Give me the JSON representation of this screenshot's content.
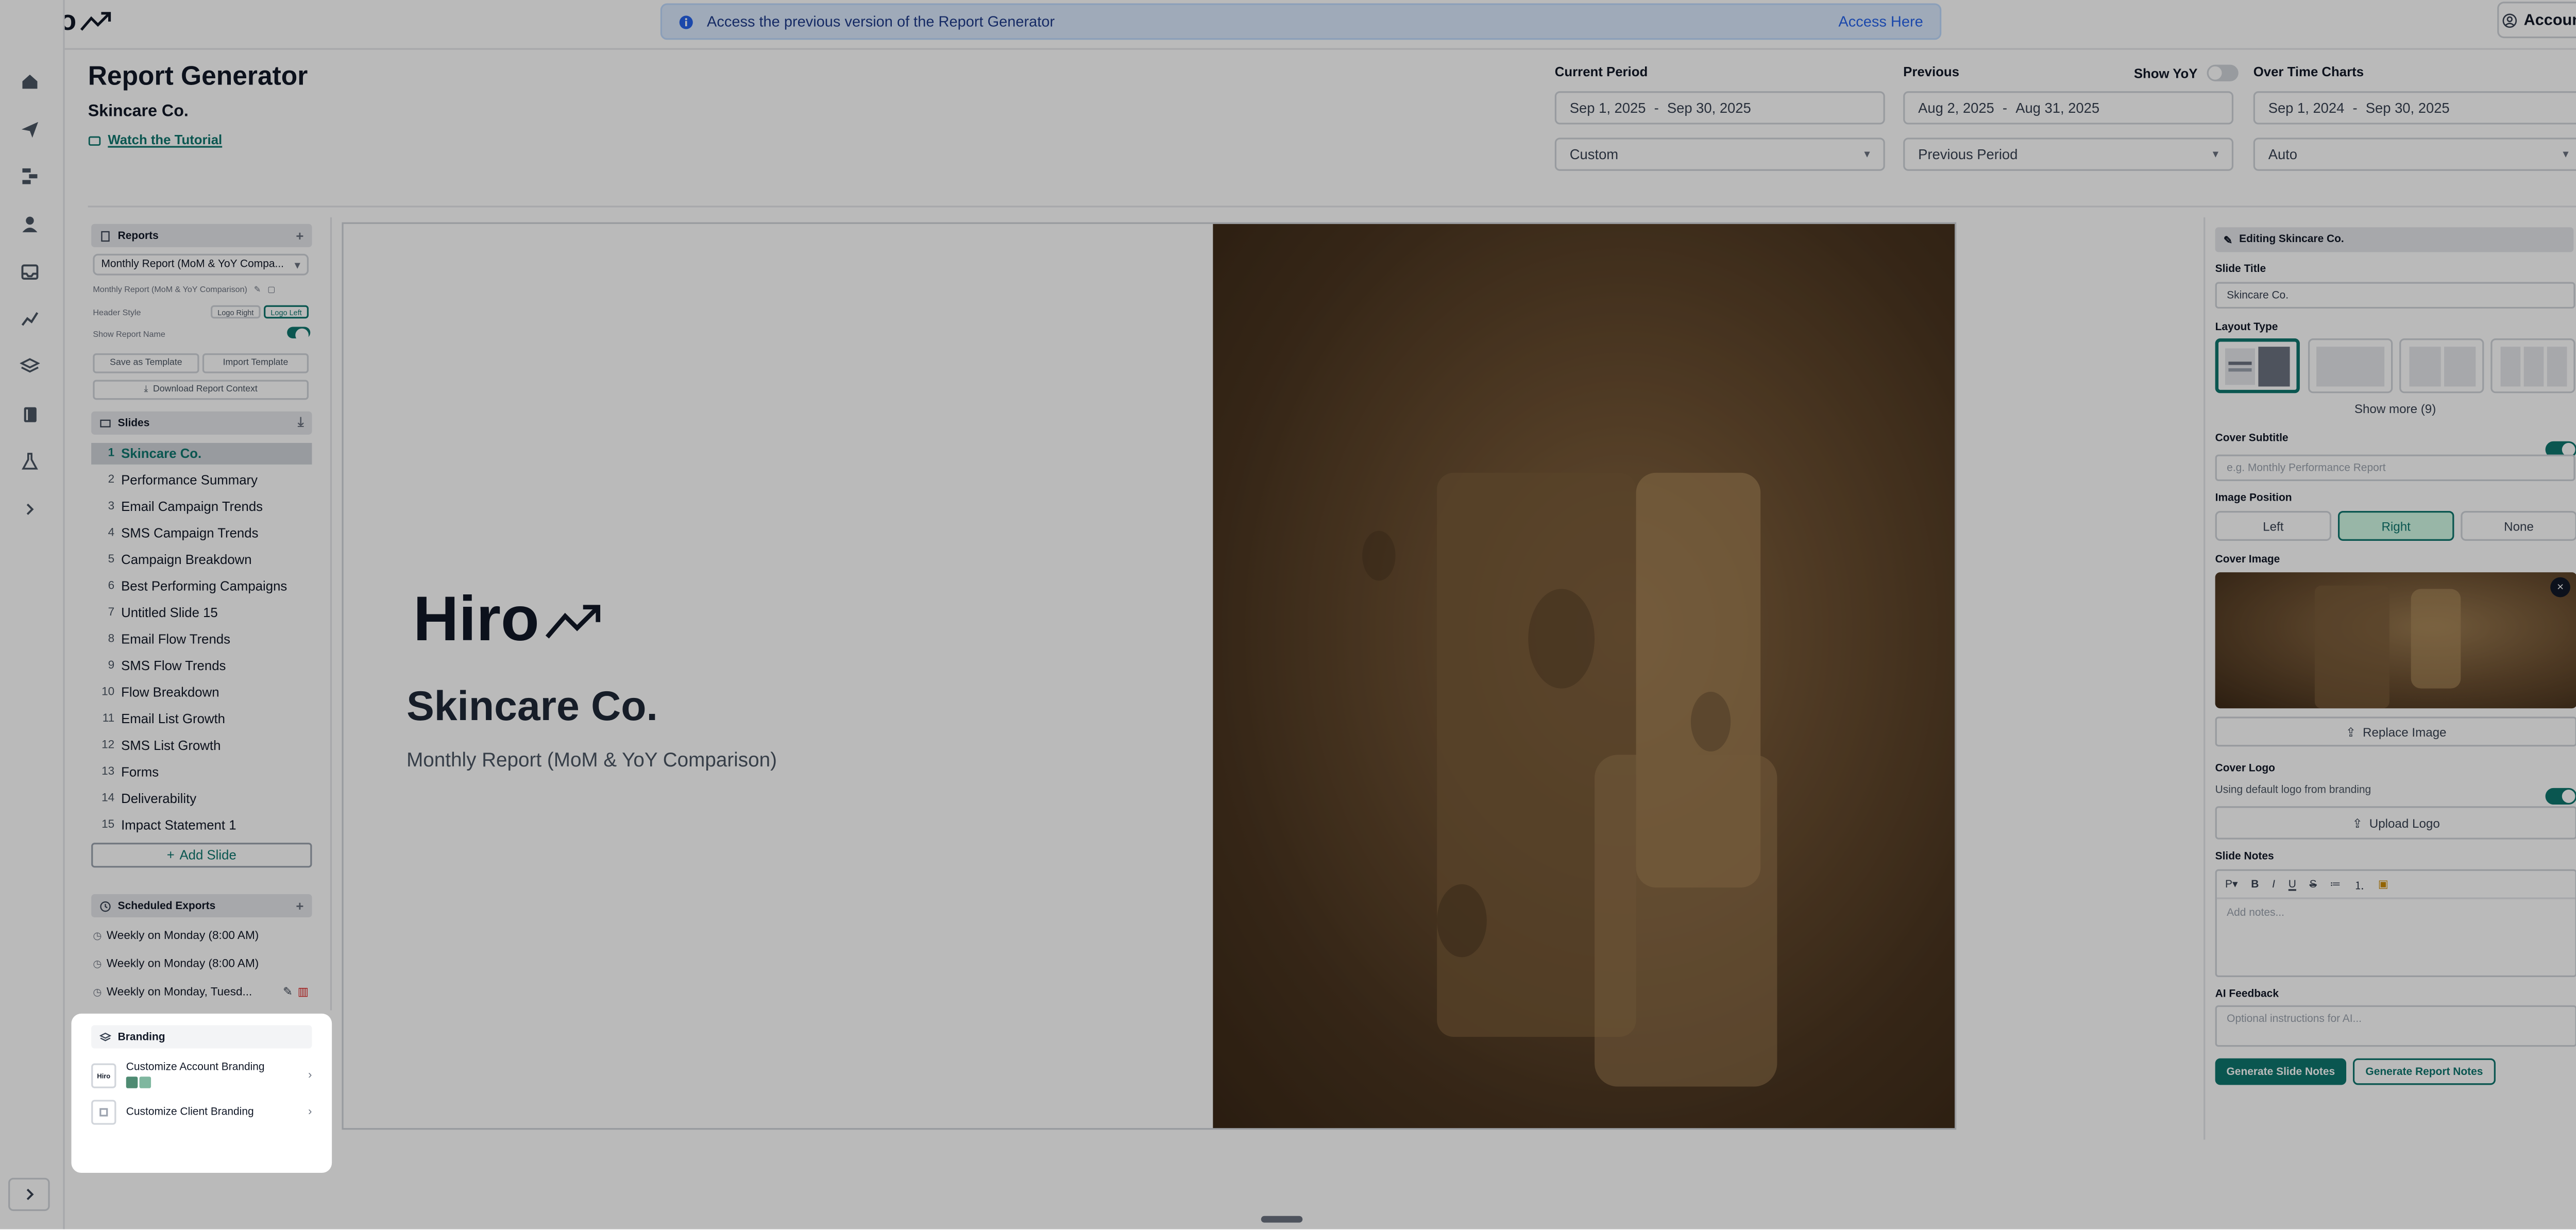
{
  "app": {
    "logo_text": "Hiro",
    "account_label": "Account"
  },
  "banner": {
    "message": "Access the previous version of the Report Generator",
    "link": "Access Here"
  },
  "header": {
    "title": "Report Generator",
    "client": "Skincare Co.",
    "tutorial_link": "Watch the Tutorial",
    "current_period": {
      "label": "Current Period",
      "start": "Sep 1, 2025",
      "end": "Sep 30, 2025",
      "mode": "Custom"
    },
    "previous": {
      "label": "Previous",
      "start": "Aug 2, 2025",
      "end": "Aug 31, 2025",
      "mode": "Previous Period",
      "yoy_label": "Show YoY"
    },
    "over_time": {
      "label": "Over Time Charts",
      "start": "Sep 1, 2024",
      "end": "Sep 30, 2025",
      "mode": "Auto"
    }
  },
  "reports": {
    "heading": "Reports",
    "selected": "Monthly Report (MoM & YoY Compa...",
    "sub_name": "Monthly Report (MoM & YoY Comparison)",
    "header_style_label": "Header Style",
    "header_style_options": [
      "Logo Right",
      "Logo Left"
    ],
    "show_name_label": "Show Report Name",
    "save_template": "Save as Template",
    "import_template": "Import Template",
    "download_context": "Download Report Context"
  },
  "slides": {
    "heading": "Slides",
    "items": [
      {
        "num": "1",
        "title": "Skincare Co."
      },
      {
        "num": "2",
        "title": "Performance Summary"
      },
      {
        "num": "3",
        "title": "Email Campaign Trends"
      },
      {
        "num": "4",
        "title": "SMS Campaign Trends"
      },
      {
        "num": "5",
        "title": "Campaign Breakdown"
      },
      {
        "num": "6",
        "title": "Best Performing Campaigns"
      },
      {
        "num": "7",
        "title": "Untitled Slide 15"
      },
      {
        "num": "8",
        "title": "Email Flow Trends"
      },
      {
        "num": "9",
        "title": "SMS Flow Trends"
      },
      {
        "num": "10",
        "title": "Flow Breakdown"
      },
      {
        "num": "11",
        "title": "Email List Growth"
      },
      {
        "num": "12",
        "title": "SMS List Growth"
      },
      {
        "num": "13",
        "title": "Forms"
      },
      {
        "num": "14",
        "title": "Deliverability"
      },
      {
        "num": "15",
        "title": "Impact Statement 1"
      }
    ],
    "add_label": "Add Slide"
  },
  "scheduled": {
    "heading": "Scheduled Exports",
    "items": [
      "Weekly on Monday (8:00 AM)",
      "Weekly on Monday (8:00 AM)",
      "Weekly on Monday, Tuesd..."
    ]
  },
  "branding": {
    "heading": "Branding",
    "account_item": "Customize Account Branding",
    "client_item": "Customize Client Branding",
    "account_logo_text": "Hiro",
    "swatches": [
      "#4e8b72",
      "#7fb79f"
    ]
  },
  "canvas": {
    "logo_text": "Hiro",
    "title": "Skincare Co.",
    "subtitle": "Monthly Report (MoM & YoY Comparison)"
  },
  "editor": {
    "heading": "Editing Skincare Co.",
    "slide_title_label": "Slide Title",
    "slide_title_value": "Skincare Co.",
    "layout_label": "Layout Type",
    "show_more": "Show more (9)",
    "cover_subtitle_label": "Cover Subtitle",
    "cover_subtitle_placeholder": "e.g. Monthly Performance Report",
    "image_position_label": "Image Position",
    "positions": [
      "Left",
      "Right",
      "None"
    ],
    "cover_image_label": "Cover Image",
    "replace_image": "Replace Image",
    "cover_logo_label": "Cover Logo",
    "cover_logo_note": "Using default logo from branding",
    "upload_logo": "Upload Logo",
    "notes_label": "Slide Notes",
    "notes_paragraph_tool": "P",
    "notes_placeholder": "Add notes...",
    "ai_label": "AI Feedback",
    "ai_placeholder": "Optional instructions for AI...",
    "gen_slide_notes": "Generate Slide Notes",
    "gen_report_notes": "Generate Report Notes"
  },
  "colors": {
    "accent": "#0f766e",
    "overlay": "rgba(0,0,0,0.27)"
  }
}
